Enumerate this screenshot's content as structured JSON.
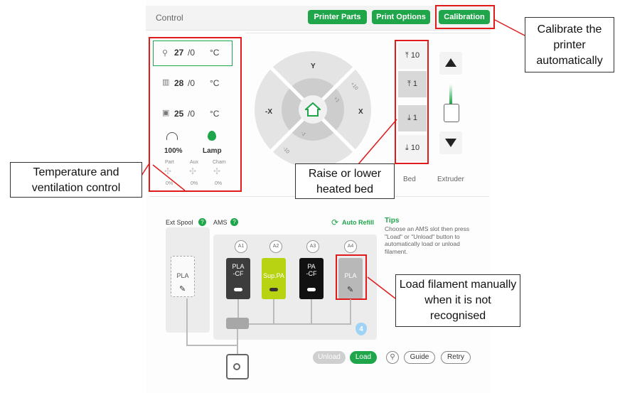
{
  "header": {
    "title": "Control",
    "buttons": [
      "Printer Parts",
      "Print Options",
      "Calibration"
    ]
  },
  "temps": [
    {
      "current": "27",
      "target": "/0",
      "unit": "°C"
    },
    {
      "current": "28",
      "target": "/0",
      "unit": "°C"
    },
    {
      "current": "25",
      "target": "/0",
      "unit": "°C"
    }
  ],
  "fan": {
    "speed": "100%",
    "lamp": "Lamp"
  },
  "fans_small": {
    "labels": [
      "Part",
      "Aux",
      "Cham"
    ],
    "values": [
      "0%",
      "0%",
      "0%"
    ]
  },
  "jog": {
    "y": "Y",
    "x_neg": "-X",
    "x_pos": "X",
    "p10": "+10",
    "p1": "+1",
    "m1": "-1",
    "m10": "-10"
  },
  "bed": {
    "buttons": [
      "10",
      "1",
      "1",
      "10"
    ],
    "label": "Bed"
  },
  "extruder": {
    "label": "Extruder"
  },
  "ams": {
    "ext_spool": "Ext Spool",
    "ams_label": "AMS",
    "help": "?",
    "auto_refill": "Auto Refill",
    "slot_ids": [
      "A1",
      "A2",
      "A3",
      "A4"
    ],
    "slots": [
      {
        "name": "PLA\n-CF",
        "color": "#3d3d3d"
      },
      {
        "name": "Sup.PA",
        "color": "#b7d312"
      },
      {
        "name": "PA\n-CF",
        "color": "#111111"
      },
      {
        "name": "PLA",
        "color": "#b8b8b8"
      }
    ],
    "ext_slot": "PLA",
    "humidity": "4",
    "tips_title": "Tips",
    "tips_text": "Choose an AMS slot then press \"Load\" or \"Unload\" button to automatically load or unload filament.",
    "unload": "Unload",
    "load": "Load",
    "guide": "Guide",
    "retry": "Retry"
  },
  "callouts": {
    "calibrate": "Calibrate the printer automatically",
    "temp": "Temperature and ventilation control",
    "bed": "Raise or lower heated bed",
    "load": "Load filament manually when it is not recognised"
  },
  "colors": {
    "accent": "#1fa64a",
    "annotation": "#e01b1b"
  }
}
